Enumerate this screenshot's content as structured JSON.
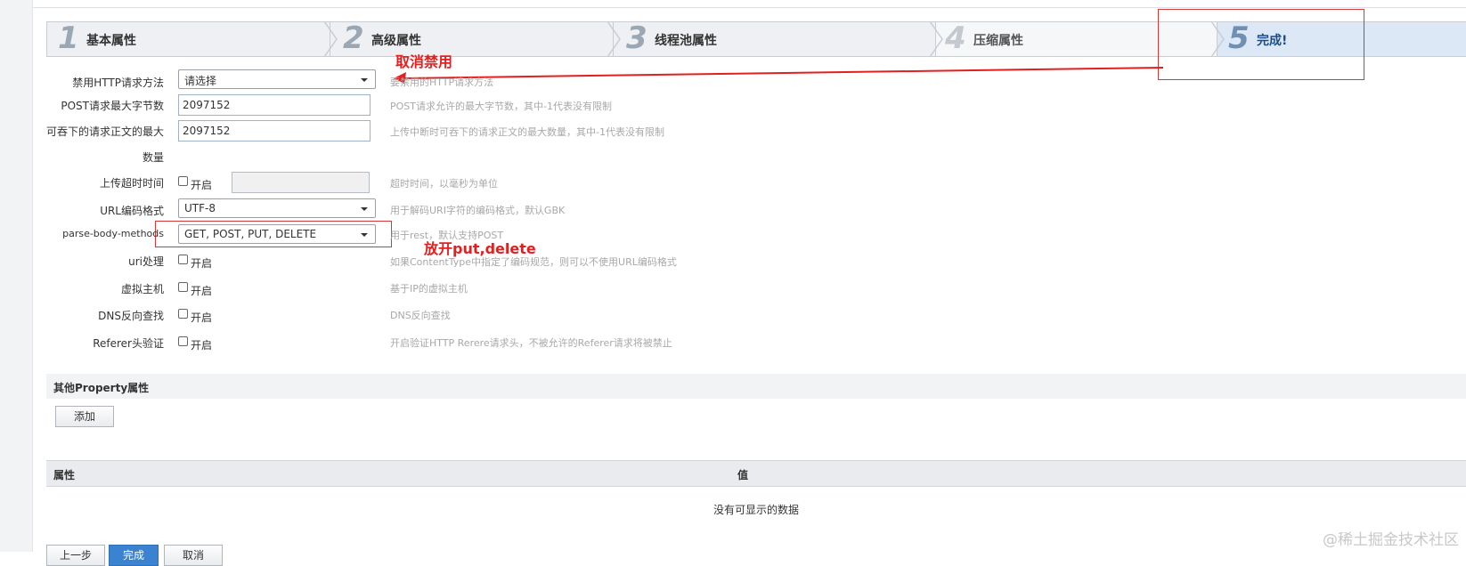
{
  "wizard": {
    "steps": [
      {
        "num": "1",
        "label": "基本属性"
      },
      {
        "num": "2",
        "label": "高级属性"
      },
      {
        "num": "3",
        "label": "线程池属性"
      },
      {
        "num": "4",
        "label": "压缩属性"
      },
      {
        "num": "5",
        "label": "完成!"
      }
    ],
    "active_step": 5
  },
  "annotations": {
    "cancel_disable": "取消禁用",
    "allow_methods": "放开put,delete"
  },
  "form": {
    "disabled_http_methods": {
      "label": "禁用HTTP请求方法",
      "value": "请选择",
      "hint": "要禁用的HTTP请求方法"
    },
    "post_max_bytes": {
      "label": "POST请求最大字节数",
      "value": "2097152",
      "hint": "POST请求允许的最大字节数，其中-1代表没有限制"
    },
    "max_swallow_size": {
      "label_line1": "可吞下的请求正文的最大",
      "label_line2": "数量",
      "value": "2097152",
      "hint": "上传中断时可吞下的请求正文的最大数量，其中-1代表没有限制"
    },
    "upload_timeout": {
      "label": "上传超时时间",
      "checkbox_label": "开启",
      "hint": "超时时间，以毫秒为单位"
    },
    "uri_encoding": {
      "label": "URL编码格式",
      "value": "UTF-8",
      "hint": "用于解码URI字符的编码格式，默认GBK"
    },
    "parse_body_methods": {
      "label": "parse-body-methods",
      "value": "GET, POST, PUT, DELETE",
      "hint": "用于rest，默认支持POST"
    },
    "uri_processing": {
      "label": "uri处理",
      "checkbox_label": "开启",
      "hint": "如果ContentType中指定了编码规范，则可以不使用URL编码格式"
    },
    "virtual_host": {
      "label": "虚拟主机",
      "checkbox_label": "开启",
      "hint": "基于IP的虚拟主机"
    },
    "dns_lookup": {
      "label": "DNS反向查找",
      "checkbox_label": "开启",
      "hint": "DNS反向查找"
    },
    "referer_check": {
      "label": "Referer头验证",
      "checkbox_label": "开启",
      "hint": "开启验证HTTP Rerere请求头，不被允许的Referer请求将被禁止"
    }
  },
  "properties": {
    "section_title": "其他Property属性",
    "add_button": "添加",
    "columns": [
      "属性",
      "值"
    ],
    "empty_message": "没有可显示的数据"
  },
  "footer": {
    "prev_button": "上一步",
    "finish_button": "完成",
    "cancel_button": "取消"
  },
  "watermark": "@稀土掘金技术社区",
  "colors": {
    "annotation_red": "#e51e1e",
    "active_step_bg": "#dce8f6",
    "primary_button": "#3b82d1"
  }
}
